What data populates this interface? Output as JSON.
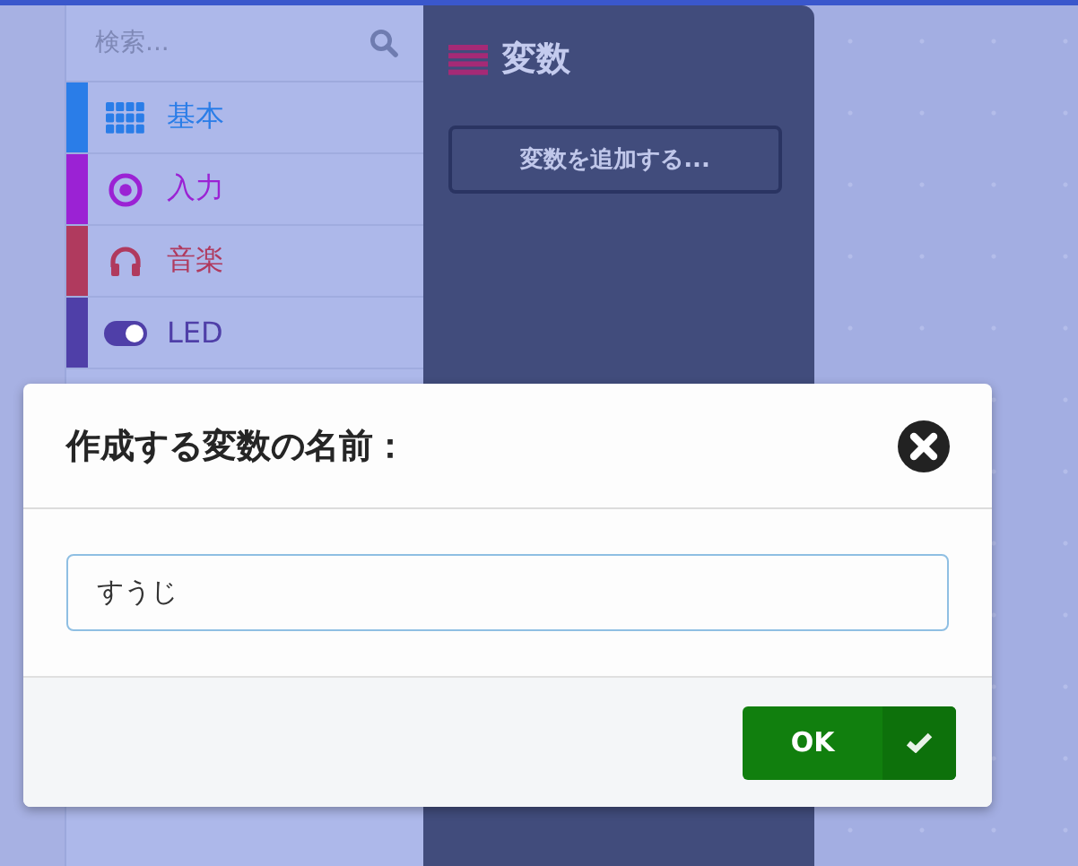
{
  "search": {
    "placeholder": "検索..."
  },
  "categories": [
    {
      "label": "基本",
      "color": "#2a7de8",
      "kind": "grid"
    },
    {
      "label": "入力",
      "color": "#9b22d4",
      "kind": "target"
    },
    {
      "label": "音楽",
      "color": "#b03a5e",
      "kind": "headphones"
    },
    {
      "label": "LED",
      "color": "#4f3fa8",
      "kind": "toggle"
    }
  ],
  "flyout": {
    "title": "変数",
    "button": "変数を追加する..."
  },
  "dialog": {
    "title": "作成する変数の名前：",
    "input": {
      "value": "すうじ"
    },
    "ok_button": "OK"
  }
}
